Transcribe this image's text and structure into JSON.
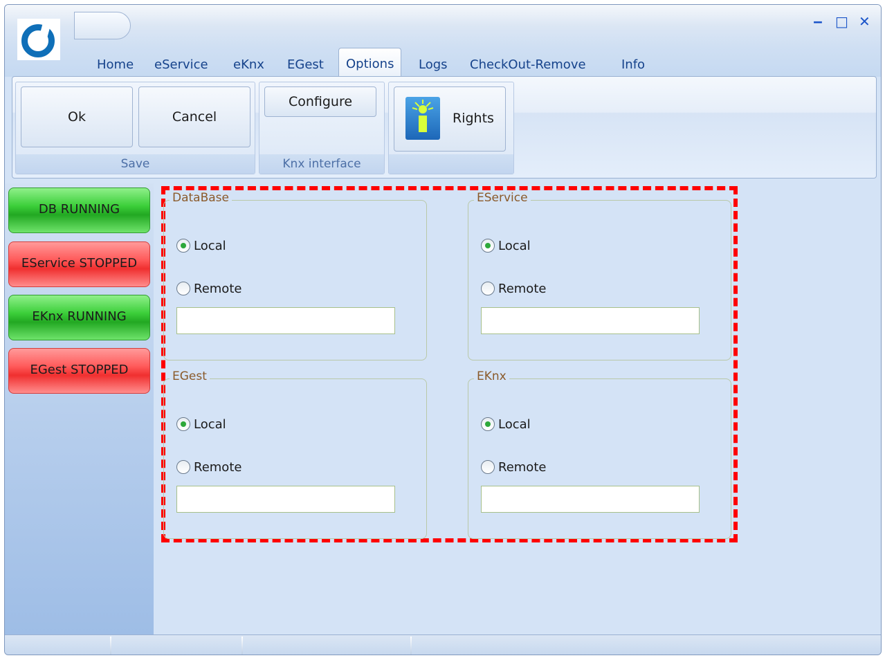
{
  "window": {
    "minimize_glyph": "‒",
    "maximize_glyph": "□",
    "close_glyph": "✕"
  },
  "tabs": [
    {
      "label": "Home"
    },
    {
      "label": "eService"
    },
    {
      "label": "eKnx"
    },
    {
      "label": "EGest"
    },
    {
      "label": "Options"
    },
    {
      "label": "Logs"
    },
    {
      "label": "CheckOut-Remove"
    },
    {
      "label": "Info"
    }
  ],
  "active_tab": "Options",
  "ribbon": {
    "save_group": {
      "label": "Save",
      "ok_label": "Ok",
      "cancel_label": "Cancel"
    },
    "knx_group": {
      "label": "Knx interface",
      "configure_label": "Configure"
    },
    "rights_group": {
      "rights_label": "Rights",
      "icon": "user-rights-icon"
    }
  },
  "status_buttons": [
    {
      "label": "DB RUNNING",
      "state": "running",
      "color": "#3ccf3a"
    },
    {
      "label": "EService STOPPED",
      "state": "stopped",
      "color": "#f02f2f"
    },
    {
      "label": "EKnx RUNNING",
      "state": "running",
      "color": "#3ccf3a"
    },
    {
      "label": "EGest STOPPED",
      "state": "stopped",
      "color": "#f02f2f"
    }
  ],
  "groups": [
    {
      "title": "DataBase",
      "local_label": "Local",
      "remote_label": "Remote",
      "selected": "Local",
      "remote_value": ""
    },
    {
      "title": "EService",
      "local_label": "Local",
      "remote_label": "Remote",
      "selected": "Local",
      "remote_value": ""
    },
    {
      "title": "EGest",
      "local_label": "Local",
      "remote_label": "Remote",
      "selected": "Local",
      "remote_value": ""
    },
    {
      "title": "EKnx",
      "local_label": "Local",
      "remote_label": "Remote",
      "selected": "Local",
      "remote_value": ""
    }
  ],
  "colors": {
    "highlight_border": "#ff0000",
    "tab_text": "#15428b",
    "group_title": "#8a5a2a"
  }
}
